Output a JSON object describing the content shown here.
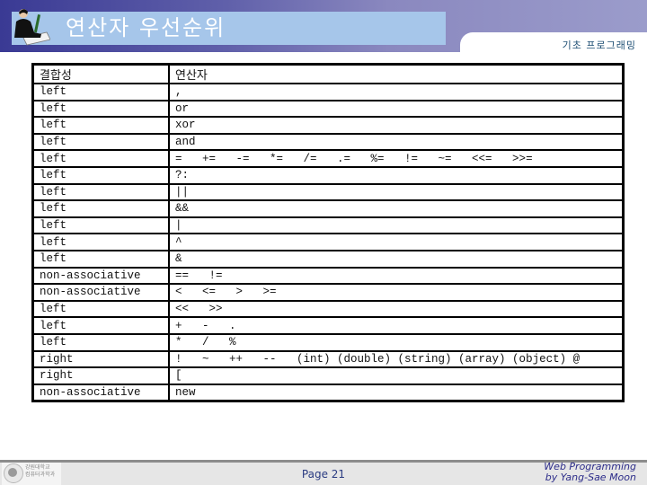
{
  "header": {
    "title": "연산자 우선순위",
    "course": "기초 프로그래밍",
    "logo_icon": "person-writing-icon"
  },
  "table": {
    "columns": [
      "결합성",
      "연산자"
    ],
    "rows": [
      {
        "assoc": "left",
        "ops": ","
      },
      {
        "assoc": "left",
        "ops": "or"
      },
      {
        "assoc": "left",
        "ops": "xor"
      },
      {
        "assoc": "left",
        "ops": "and"
      },
      {
        "assoc": "left",
        "ops": "=   +=   -=   *=   /=   .=   %=   !=   ~=   <<=   >>="
      },
      {
        "assoc": "left",
        "ops": "?:"
      },
      {
        "assoc": "left",
        "ops": "||"
      },
      {
        "assoc": "left",
        "ops": "&&"
      },
      {
        "assoc": "left",
        "ops": "|"
      },
      {
        "assoc": "left",
        "ops": "^"
      },
      {
        "assoc": "left",
        "ops": "&"
      },
      {
        "assoc": "non-associative",
        "ops": "==   !="
      },
      {
        "assoc": "non-associative",
        "ops": "<   <=   >   >="
      },
      {
        "assoc": "left",
        "ops": "<<   >>"
      },
      {
        "assoc": "left",
        "ops": "+   -   ."
      },
      {
        "assoc": "left",
        "ops": "*   /   %"
      },
      {
        "assoc": "right",
        "ops": "!   ~   ++   --   (int) (double) (string) (array) (object) @"
      },
      {
        "assoc": "right",
        "ops": "["
      },
      {
        "assoc": "non-associative",
        "ops": "new"
      }
    ]
  },
  "footer": {
    "university": [
      "강원대학교",
      "컴퓨터과학과"
    ],
    "page": "Page 21",
    "credit_line1": "Web Programming",
    "credit_line2": "by Yang-Sae Moon"
  }
}
